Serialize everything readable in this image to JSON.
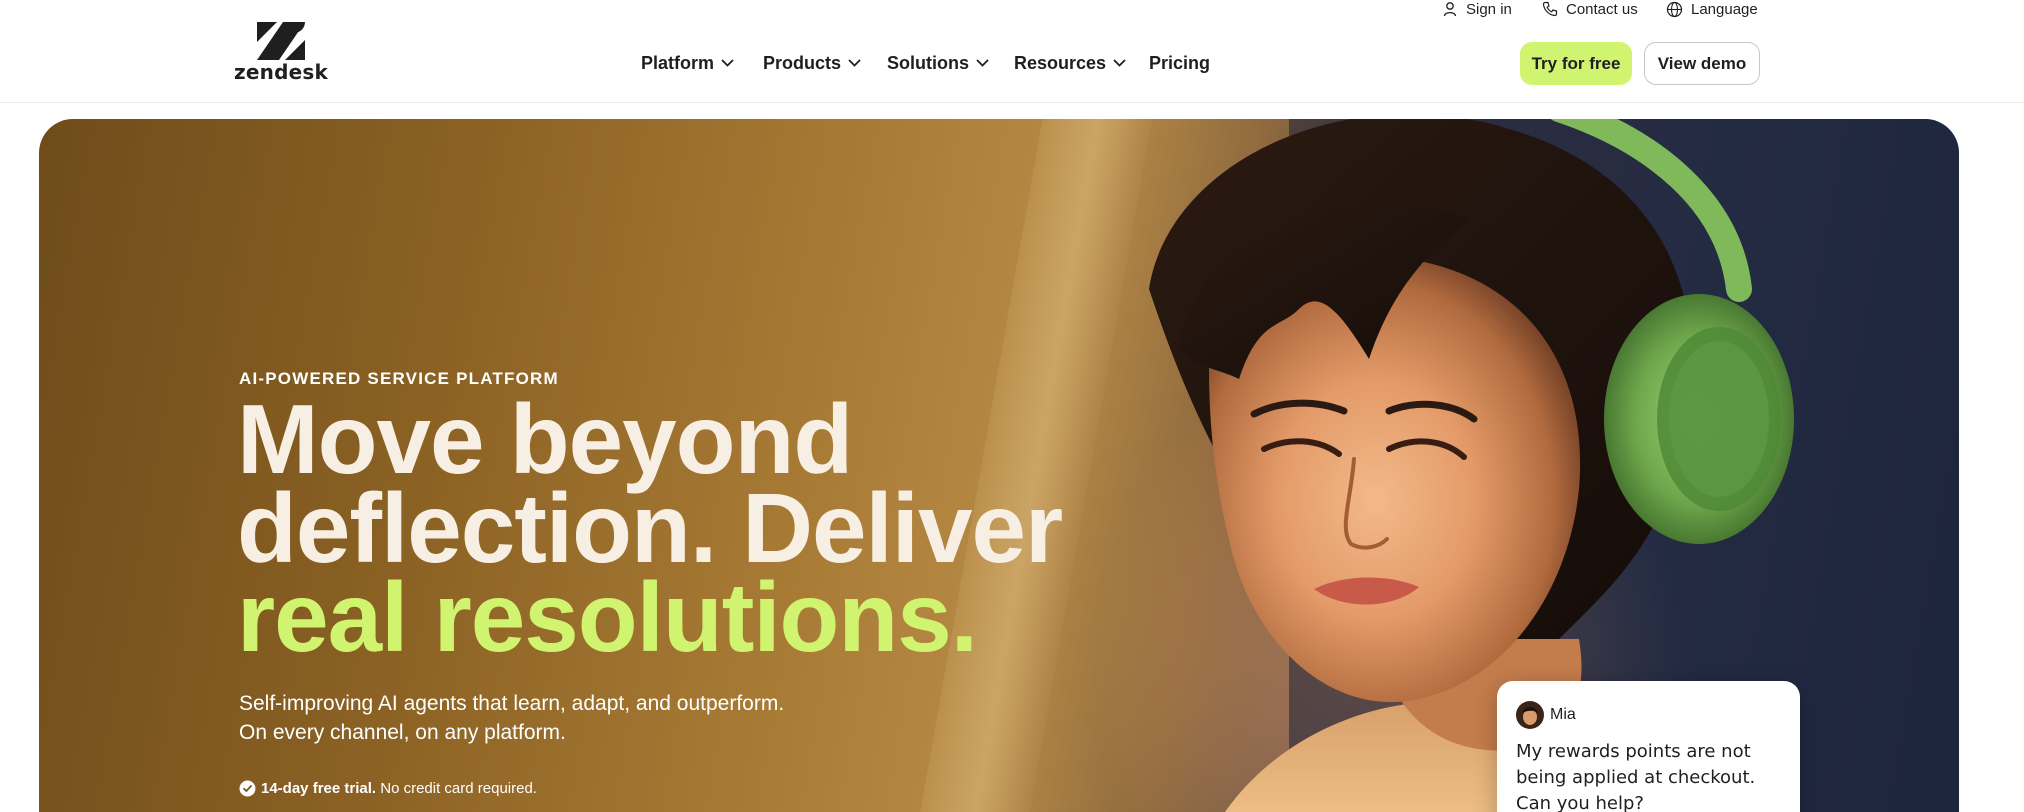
{
  "header": {
    "logo_text": "zendesk",
    "utility": {
      "sign_in": "Sign in",
      "contact": "Contact us",
      "language": "Language"
    },
    "nav": [
      {
        "label": "Platform",
        "icon": "chevron-down-icon"
      },
      {
        "label": "Products",
        "icon": "chevron-down-icon"
      },
      {
        "label": "Solutions",
        "icon": "chevron-down-icon"
      },
      {
        "label": "Resources",
        "icon": "chevron-down-icon"
      },
      {
        "label": "Pricing"
      }
    ],
    "try_label": "Try for free",
    "demo_label": "View demo"
  },
  "hero": {
    "eyebrow": "AI-POWERED SERVICE PLATFORM",
    "headline_line1": "Move beyond",
    "headline_line2": "deflection. Deliver",
    "headline_line3": "real resolutions.",
    "sub_line1": "Self-improving AI agents that learn, adapt, and outperform.",
    "sub_line2": "On every channel, on any platform.",
    "trial_bold": "14-day free trial.",
    "trial_rest": "No credit card required.",
    "chat": {
      "name": "Mia",
      "message": "My rewards points are not being applied at checkout. Can you help?"
    }
  },
  "colors": {
    "accent": "#d1f470",
    "text_dark": "#1f1f1f",
    "headline": "#f7efe3"
  }
}
